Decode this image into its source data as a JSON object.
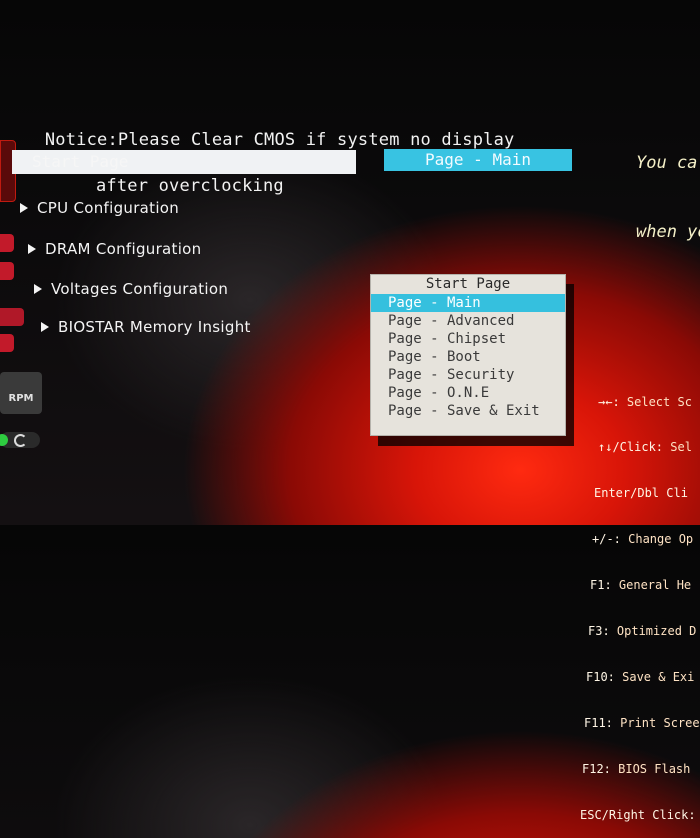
{
  "notice": {
    "line1": "Notice:Please Clear CMOS if system no display",
    "line2": "after overclocking"
  },
  "right_hint": {
    "line1": "You ca",
    "line2": "when yo"
  },
  "start_page_bar": {
    "label": "Start Page"
  },
  "page_main_button": {
    "label": "Page - Main"
  },
  "menu": [
    {
      "label": "CPU Configuration"
    },
    {
      "label": "DRAM Configuration"
    },
    {
      "label": "Voltages Configuration"
    },
    {
      "label": "BIOSTAR Memory Insight"
    }
  ],
  "dropdown": {
    "title": "Start Page",
    "selected_index": 0,
    "options": [
      "Page - Main",
      "Page - Advanced",
      "Page - Chipset",
      "Page - Boot",
      "Page - Security",
      "Page - O.N.E",
      "Page - Save & Exit"
    ]
  },
  "help": [
    {
      "key": "→←:",
      "desc": " Select Sc"
    },
    {
      "key": "↑↓/Click:",
      "desc": " Sel"
    },
    {
      "key": "Enter/Dbl Cli",
      "desc": ""
    },
    {
      "key": "+/-:",
      "desc": " Change Op"
    },
    {
      "key": "F1:",
      "desc": " General He"
    },
    {
      "key": "F3:",
      "desc": " Optimized D"
    },
    {
      "key": "F10:",
      "desc": " Save & Exi"
    },
    {
      "key": "F11:",
      "desc": " Print Scree"
    },
    {
      "key": "F12:",
      "desc": " BIOS Flash"
    },
    {
      "key": "ESC/Right Click:",
      "desc": ""
    }
  ],
  "left_badges": {
    "rpm_label": "RPM"
  },
  "colors": {
    "accent": "#38c3e2",
    "background": "#0b0a0b",
    "glow": "#e0180a"
  }
}
